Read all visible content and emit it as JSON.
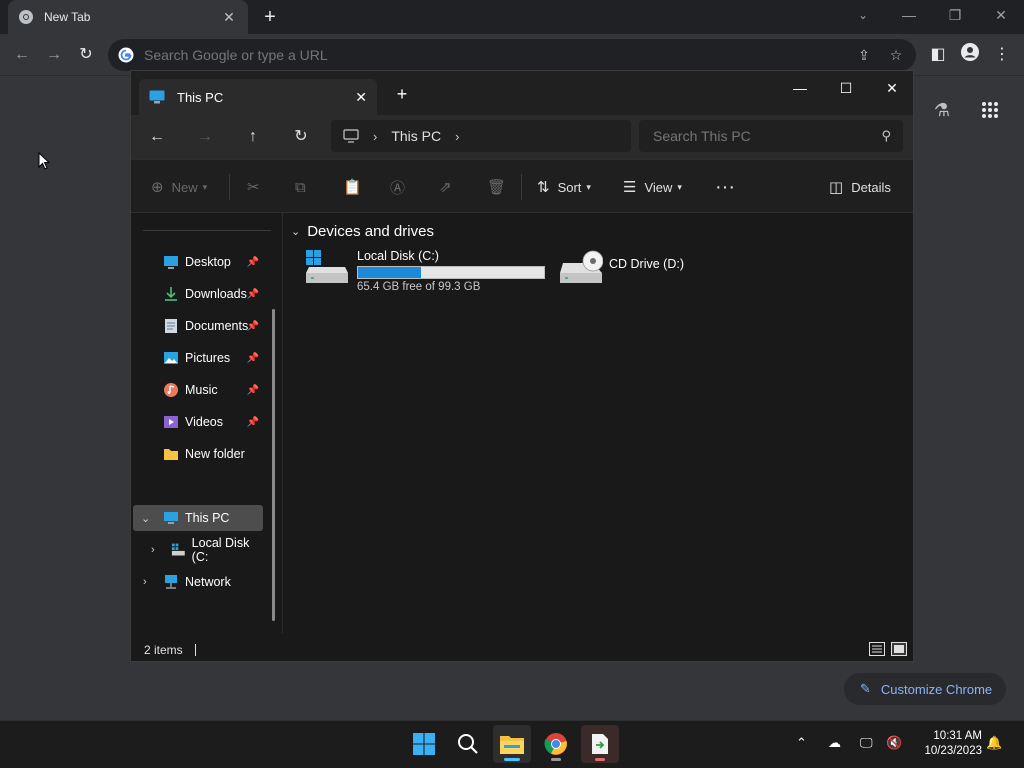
{
  "chrome": {
    "tab_title": "New Tab",
    "omnibox_placeholder": "Search Google or type a URL",
    "customize_label": "Customize Chrome"
  },
  "explorer": {
    "tab_title": "This PC",
    "breadcrumb": [
      "This PC"
    ],
    "search_placeholder": "Search This PC",
    "commands": {
      "new": "New",
      "sort": "Sort",
      "view": "View",
      "details": "Details"
    },
    "nav": {
      "quick_access": [
        {
          "label": "Desktop",
          "icon": "desktop-icon",
          "pinned": true
        },
        {
          "label": "Downloads",
          "icon": "download-icon",
          "pinned": true
        },
        {
          "label": "Documents",
          "icon": "document-icon",
          "pinned": true
        },
        {
          "label": "Pictures",
          "icon": "pictures-icon",
          "pinned": true
        },
        {
          "label": "Music",
          "icon": "music-icon",
          "pinned": true
        },
        {
          "label": "Videos",
          "icon": "videos-icon",
          "pinned": true
        },
        {
          "label": "New folder",
          "icon": "folder-icon",
          "pinned": false
        }
      ],
      "this_pc": "This PC",
      "local_disk": "Local Disk (C:",
      "network": "Network"
    },
    "group_header": "Devices and drives",
    "drives": [
      {
        "name": "Local Disk (C:)",
        "free_text": "65.4 GB free of 99.3 GB",
        "used_fraction": 0.34
      },
      {
        "name": "CD Drive (D:)"
      }
    ],
    "status": "2 items"
  },
  "taskbar": {
    "time": "10:31 AM",
    "date": "10/23/2023"
  },
  "colors": {
    "accent": "#1c8ad8",
    "chrome_bg": "#35363a",
    "explorer_bg": "#191919",
    "link": "#8ab4f8"
  }
}
